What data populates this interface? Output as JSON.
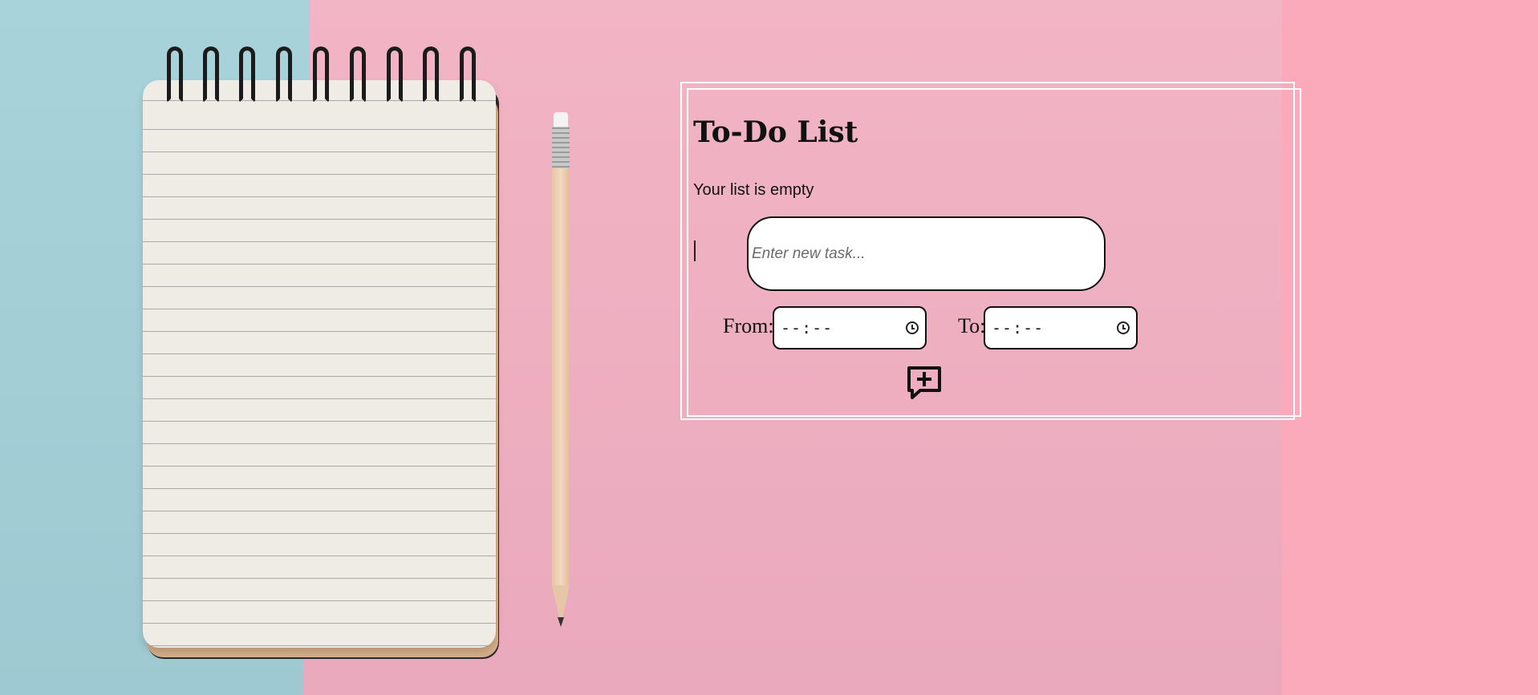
{
  "todo": {
    "title": "To-Do List",
    "empty_message": "Your list is empty",
    "task_input": {
      "placeholder": "Enter new task...",
      "value": ""
    },
    "from": {
      "label": "From:",
      "value": "--:--"
    },
    "to": {
      "label": "To:",
      "value": "--:--"
    },
    "add_button_icon": "chat-plus-icon"
  },
  "colors": {
    "blue_background": "#a9d3da",
    "pink_background": "#f2b5c5",
    "pink_right_band": "#fbaabb",
    "card_border": "#ffffff"
  }
}
